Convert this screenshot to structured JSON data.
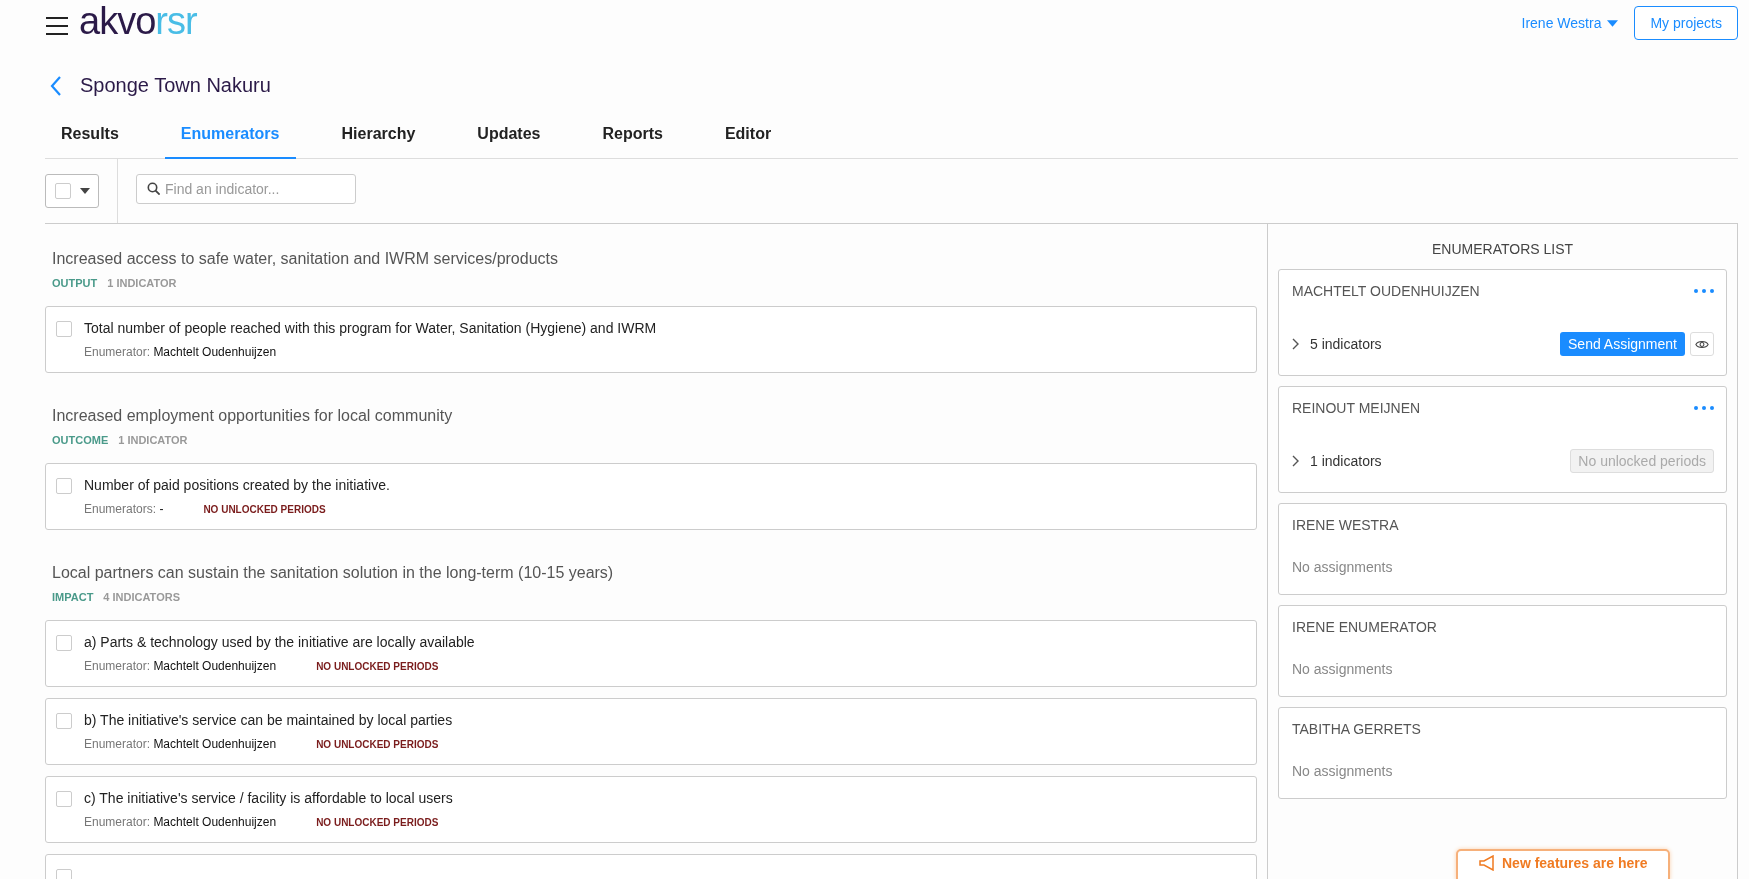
{
  "header": {
    "logo": {
      "left": "akvo",
      "right": "rsr"
    },
    "user": "Irene Westra",
    "projects_button": "My projects"
  },
  "project": {
    "title": "Sponge Town Nakuru"
  },
  "tabs": [
    {
      "label": "Results",
      "selected": false
    },
    {
      "label": "Enumerators",
      "selected": true
    },
    {
      "label": "Hierarchy",
      "selected": false
    },
    {
      "label": "Updates",
      "selected": false
    },
    {
      "label": "Reports",
      "selected": false
    },
    {
      "label": "Editor",
      "selected": false
    }
  ],
  "toolbar": {
    "select_all": {
      "checked": false
    },
    "search": {
      "placeholder": "Find an indicator..."
    }
  },
  "results": [
    {
      "title": "Increased access to safe water, sanitation and IWRM services/products",
      "type": "OUTPUT",
      "count": "1 INDICATOR",
      "indicators": [
        {
          "title": "Total number of people reached with this program for Water, Sanitation (Hygiene) and IWRM",
          "checked": false,
          "enumerator_label": "Enumerator:",
          "enumerator": "Machtelt Oudenhuijzen"
        }
      ]
    },
    {
      "title": "Increased employment opportunities for local community",
      "type": "OUTCOME",
      "count": "1 INDICATOR",
      "indicators": [
        {
          "title": "Number of paid positions created by the initiative.",
          "checked": false,
          "enumerator_label": "Enumerators:",
          "enumerator": "-",
          "status": "NO UNLOCKED PERIODS"
        }
      ]
    },
    {
      "title": "Local partners can sustain the sanitation solution in the long-term (10-15 years)",
      "type": "IMPACT",
      "count": "4 INDICATORS",
      "partial_indicator": {
        "checked": false
      },
      "indicators": [
        {
          "title": "a) Parts & technology used by the initiative are locally available",
          "checked": false,
          "enumerator_label": "Enumerator:",
          "enumerator": "Machtelt Oudenhuijzen",
          "status": "NO UNLOCKED PERIODS"
        },
        {
          "title": "b) The initiative's service can be maintained by local parties",
          "checked": false,
          "enumerator_label": "Enumerator:",
          "enumerator": "Machtelt Oudenhuijzen",
          "status": "NO UNLOCKED PERIODS"
        },
        {
          "title": "c) The initiative's service / facility is affordable to local users",
          "checked": false,
          "enumerator_label": "Enumerator:",
          "enumerator": "Machtelt Oudenhuijzen",
          "status": "NO UNLOCKED PERIODS"
        }
      ]
    }
  ],
  "enumerators_panel": {
    "title": "ENUMERATORS LIST",
    "items": [
      {
        "kind": "assigned",
        "name": "MACHTELT OUDENHUIJZEN",
        "expanded": false,
        "count": "5 indicators",
        "action": {
          "kind": "button",
          "label": "Send Assignment"
        }
      },
      {
        "kind": "assigned",
        "name": "REINOUT MEIJNEN",
        "expanded": false,
        "count": "1 indicators",
        "action": {
          "kind": "disabled",
          "label": "No unlocked periods"
        }
      },
      {
        "kind": "none",
        "name": "IRENE WESTRA",
        "note": "No assignments"
      },
      {
        "kind": "none",
        "name": "IRENE ENUMERATOR",
        "note": "No assignments"
      },
      {
        "kind": "none",
        "name": "TABITHA GERRETS",
        "note": "No assignments"
      }
    ]
  },
  "toast": {
    "label": "New features are here"
  }
}
